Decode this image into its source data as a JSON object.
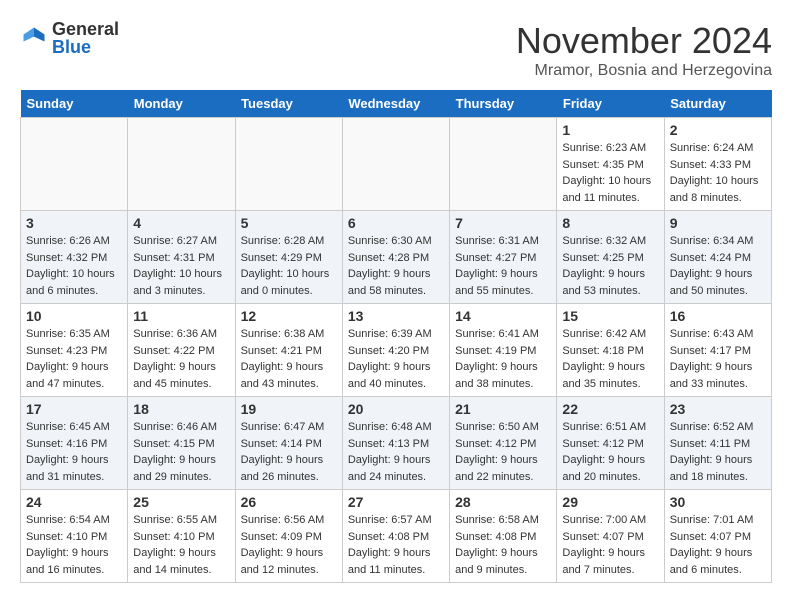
{
  "logo": {
    "general": "General",
    "blue": "Blue"
  },
  "title": "November 2024",
  "location": "Mramor, Bosnia and Herzegovina",
  "headers": [
    "Sunday",
    "Monday",
    "Tuesday",
    "Wednesday",
    "Thursday",
    "Friday",
    "Saturday"
  ],
  "weeks": [
    [
      {
        "day": "",
        "info": ""
      },
      {
        "day": "",
        "info": ""
      },
      {
        "day": "",
        "info": ""
      },
      {
        "day": "",
        "info": ""
      },
      {
        "day": "",
        "info": ""
      },
      {
        "day": "1",
        "info": "Sunrise: 6:23 AM\nSunset: 4:35 PM\nDaylight: 10 hours and 11 minutes."
      },
      {
        "day": "2",
        "info": "Sunrise: 6:24 AM\nSunset: 4:33 PM\nDaylight: 10 hours and 8 minutes."
      }
    ],
    [
      {
        "day": "3",
        "info": "Sunrise: 6:26 AM\nSunset: 4:32 PM\nDaylight: 10 hours and 6 minutes."
      },
      {
        "day": "4",
        "info": "Sunrise: 6:27 AM\nSunset: 4:31 PM\nDaylight: 10 hours and 3 minutes."
      },
      {
        "day": "5",
        "info": "Sunrise: 6:28 AM\nSunset: 4:29 PM\nDaylight: 10 hours and 0 minutes."
      },
      {
        "day": "6",
        "info": "Sunrise: 6:30 AM\nSunset: 4:28 PM\nDaylight: 9 hours and 58 minutes."
      },
      {
        "day": "7",
        "info": "Sunrise: 6:31 AM\nSunset: 4:27 PM\nDaylight: 9 hours and 55 minutes."
      },
      {
        "day": "8",
        "info": "Sunrise: 6:32 AM\nSunset: 4:25 PM\nDaylight: 9 hours and 53 minutes."
      },
      {
        "day": "9",
        "info": "Sunrise: 6:34 AM\nSunset: 4:24 PM\nDaylight: 9 hours and 50 minutes."
      }
    ],
    [
      {
        "day": "10",
        "info": "Sunrise: 6:35 AM\nSunset: 4:23 PM\nDaylight: 9 hours and 47 minutes."
      },
      {
        "day": "11",
        "info": "Sunrise: 6:36 AM\nSunset: 4:22 PM\nDaylight: 9 hours and 45 minutes."
      },
      {
        "day": "12",
        "info": "Sunrise: 6:38 AM\nSunset: 4:21 PM\nDaylight: 9 hours and 43 minutes."
      },
      {
        "day": "13",
        "info": "Sunrise: 6:39 AM\nSunset: 4:20 PM\nDaylight: 9 hours and 40 minutes."
      },
      {
        "day": "14",
        "info": "Sunrise: 6:41 AM\nSunset: 4:19 PM\nDaylight: 9 hours and 38 minutes."
      },
      {
        "day": "15",
        "info": "Sunrise: 6:42 AM\nSunset: 4:18 PM\nDaylight: 9 hours and 35 minutes."
      },
      {
        "day": "16",
        "info": "Sunrise: 6:43 AM\nSunset: 4:17 PM\nDaylight: 9 hours and 33 minutes."
      }
    ],
    [
      {
        "day": "17",
        "info": "Sunrise: 6:45 AM\nSunset: 4:16 PM\nDaylight: 9 hours and 31 minutes."
      },
      {
        "day": "18",
        "info": "Sunrise: 6:46 AM\nSunset: 4:15 PM\nDaylight: 9 hours and 29 minutes."
      },
      {
        "day": "19",
        "info": "Sunrise: 6:47 AM\nSunset: 4:14 PM\nDaylight: 9 hours and 26 minutes."
      },
      {
        "day": "20",
        "info": "Sunrise: 6:48 AM\nSunset: 4:13 PM\nDaylight: 9 hours and 24 minutes."
      },
      {
        "day": "21",
        "info": "Sunrise: 6:50 AM\nSunset: 4:12 PM\nDaylight: 9 hours and 22 minutes."
      },
      {
        "day": "22",
        "info": "Sunrise: 6:51 AM\nSunset: 4:12 PM\nDaylight: 9 hours and 20 minutes."
      },
      {
        "day": "23",
        "info": "Sunrise: 6:52 AM\nSunset: 4:11 PM\nDaylight: 9 hours and 18 minutes."
      }
    ],
    [
      {
        "day": "24",
        "info": "Sunrise: 6:54 AM\nSunset: 4:10 PM\nDaylight: 9 hours and 16 minutes."
      },
      {
        "day": "25",
        "info": "Sunrise: 6:55 AM\nSunset: 4:10 PM\nDaylight: 9 hours and 14 minutes."
      },
      {
        "day": "26",
        "info": "Sunrise: 6:56 AM\nSunset: 4:09 PM\nDaylight: 9 hours and 12 minutes."
      },
      {
        "day": "27",
        "info": "Sunrise: 6:57 AM\nSunset: 4:08 PM\nDaylight: 9 hours and 11 minutes."
      },
      {
        "day": "28",
        "info": "Sunrise: 6:58 AM\nSunset: 4:08 PM\nDaylight: 9 hours and 9 minutes."
      },
      {
        "day": "29",
        "info": "Sunrise: 7:00 AM\nSunset: 4:07 PM\nDaylight: 9 hours and 7 minutes."
      },
      {
        "day": "30",
        "info": "Sunrise: 7:01 AM\nSunset: 4:07 PM\nDaylight: 9 hours and 6 minutes."
      }
    ]
  ]
}
